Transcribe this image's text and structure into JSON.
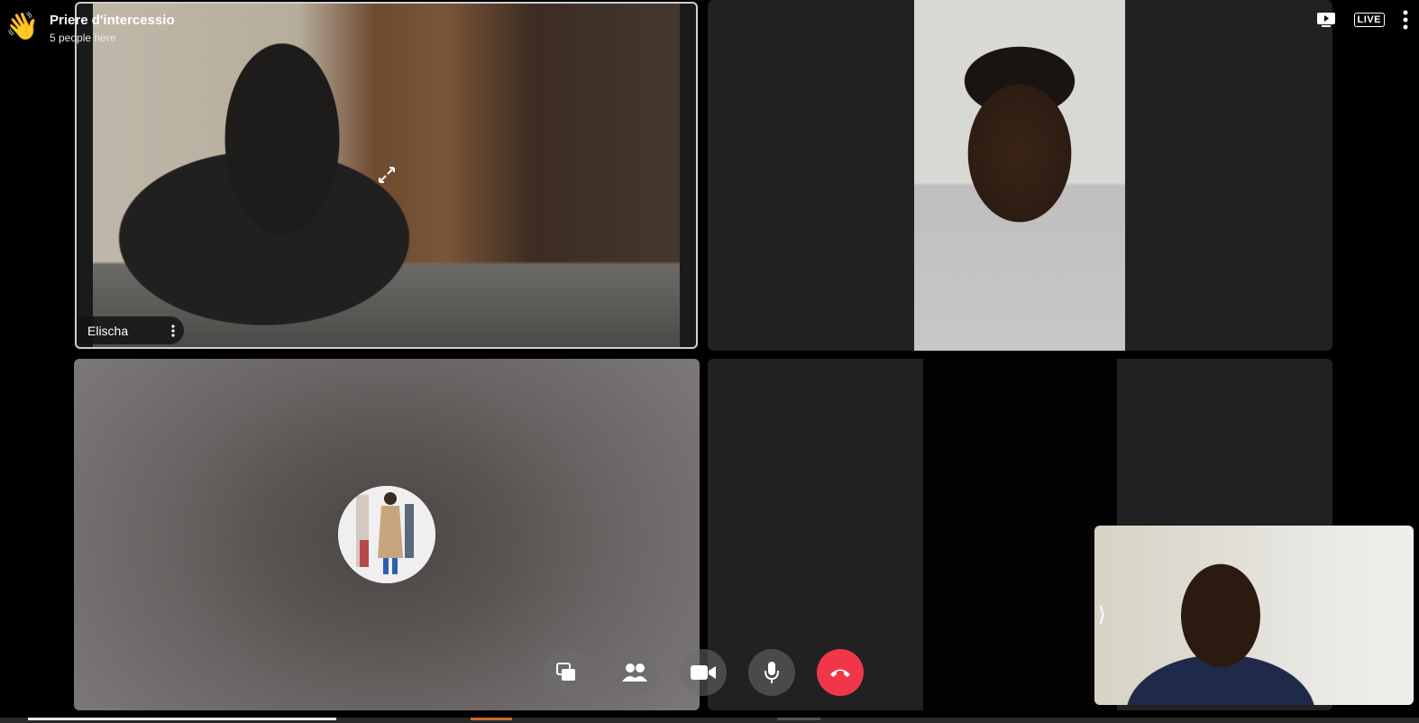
{
  "header": {
    "emoji": "👋",
    "title": "Priere d'intercessio",
    "subtitle": "5 people here"
  },
  "top_right": {
    "live_label": "LIVE",
    "icons": [
      "screen-share-icon",
      "live-icon",
      "more-vert-icon"
    ]
  },
  "tiles": [
    {
      "name": "Elischa",
      "pinned": true
    },
    {
      "name": ""
    },
    {
      "name": ""
    },
    {
      "name": ""
    }
  ],
  "self_view": {
    "chevron": "⟩"
  },
  "controls": [
    "switch-view-icon",
    "participants-icon",
    "camera-icon",
    "microphone-icon",
    "end-call-icon"
  ],
  "colors": {
    "end_call": "#f0374a",
    "background": "#000000",
    "tile": "#212121"
  }
}
